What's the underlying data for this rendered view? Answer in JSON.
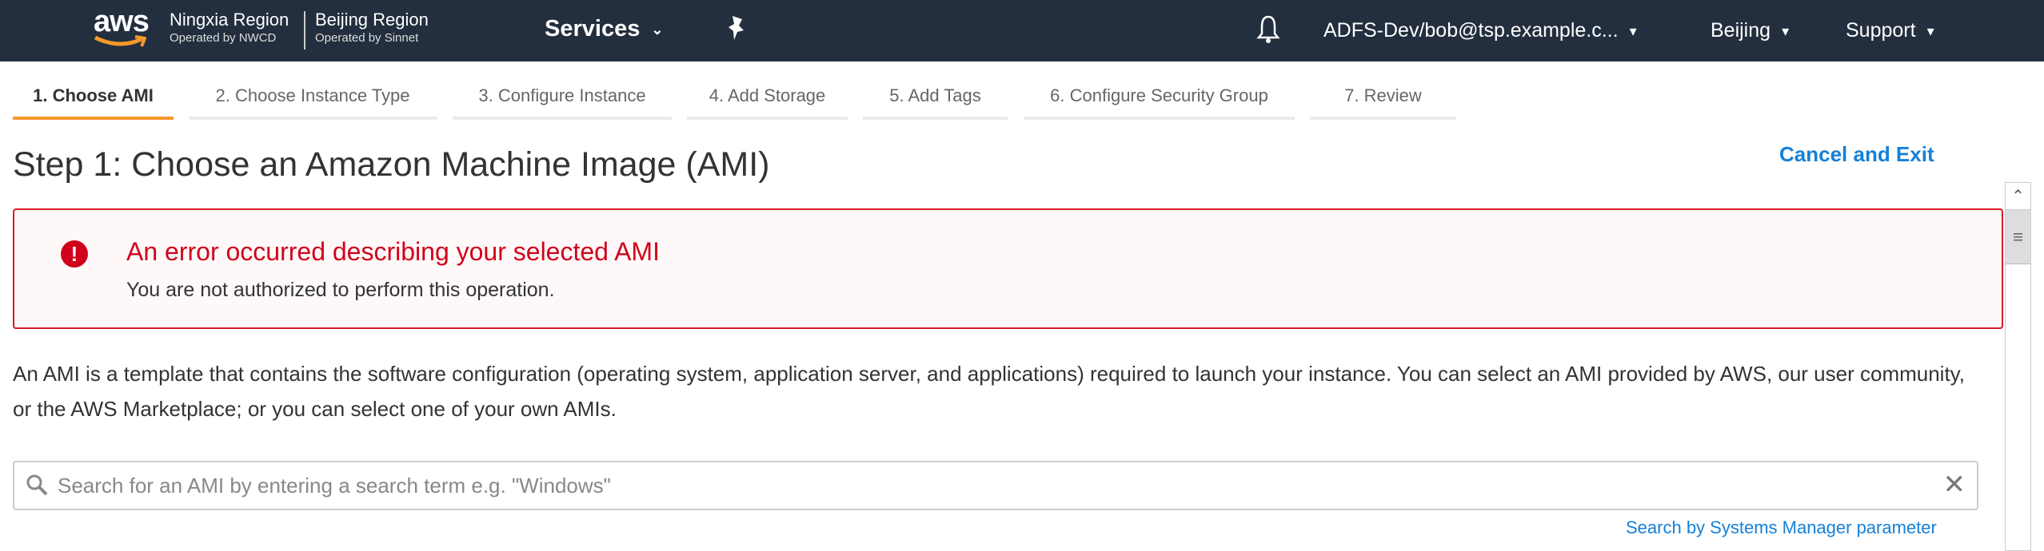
{
  "nav": {
    "logo_text": "aws",
    "region1": "Ningxia Region",
    "region1_sub": "Operated by NWCD",
    "region2": "Beijing Region",
    "region2_sub": "Operated by Sinnet",
    "services": "Services",
    "account": "ADFS-Dev/bob@tsp.example.c...",
    "region": "Beijing",
    "support": "Support"
  },
  "tabs": [
    {
      "label": "1. Choose AMI"
    },
    {
      "label": "2. Choose Instance Type"
    },
    {
      "label": "3. Configure Instance"
    },
    {
      "label": "4. Add Storage"
    },
    {
      "label": "5. Add Tags"
    },
    {
      "label": "6. Configure Security Group"
    },
    {
      "label": "7. Review"
    }
  ],
  "page": {
    "title": "Step 1: Choose an Amazon Machine Image (AMI)",
    "cancel": "Cancel and Exit",
    "error_title": "An error occurred describing your selected AMI",
    "error_message": "You are not authorized to perform this operation.",
    "description": "An AMI is a template that contains the software configuration (operating system, application server, and applications) required to launch your instance. You can select an AMI provided by AWS, our user community, or the AWS Marketplace; or you can select one of your own AMIs.",
    "search_placeholder": "Search for an AMI by entering a search term e.g. \"Windows\"",
    "search_value": "",
    "ssm_link": "Search by Systems Manager parameter"
  },
  "colors": {
    "nav": "#232f3e",
    "accent": "#f7982a",
    "error": "#d0021b",
    "link": "#1580d8"
  }
}
